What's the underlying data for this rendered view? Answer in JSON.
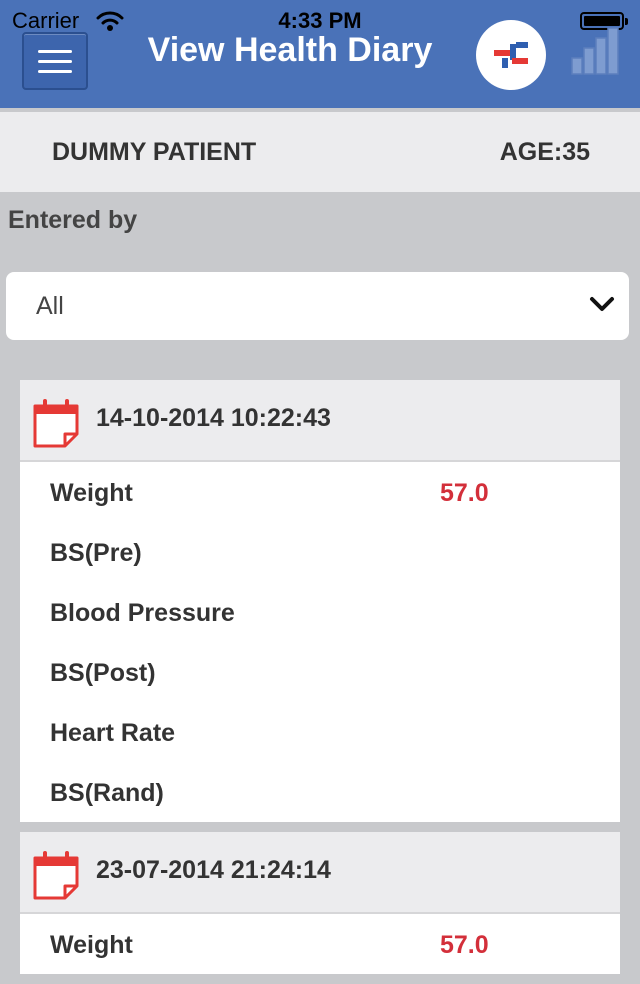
{
  "status_bar": {
    "carrier": "Carrier",
    "time": "4:33 PM"
  },
  "header": {
    "title": "View Health Diary",
    "menu_icon": "hamburger-icon",
    "logo_icon": "app-logo",
    "chart_icon": "bar-chart-icon",
    "background_color": "#4a72b8"
  },
  "patient": {
    "name": "DUMMY PATIENT",
    "age": "AGE:35"
  },
  "filter": {
    "label": "Entered by",
    "selected": "All"
  },
  "colors": {
    "value_red": "#d32f3a",
    "calendar_red": "#e53935"
  },
  "entries": [
    {
      "datetime": "14-10-2014 10:22:43",
      "rows": [
        {
          "label": "Weight",
          "value": "57.0"
        },
        {
          "label": "BS(Pre)",
          "value": ""
        },
        {
          "label": "Blood Pressure",
          "value": ""
        },
        {
          "label": "BS(Post)",
          "value": ""
        },
        {
          "label": "Heart Rate",
          "value": ""
        },
        {
          "label": "BS(Rand)",
          "value": ""
        }
      ]
    },
    {
      "datetime": "23-07-2014 21:24:14",
      "rows": [
        {
          "label": "Weight",
          "value": "57.0"
        }
      ]
    }
  ]
}
